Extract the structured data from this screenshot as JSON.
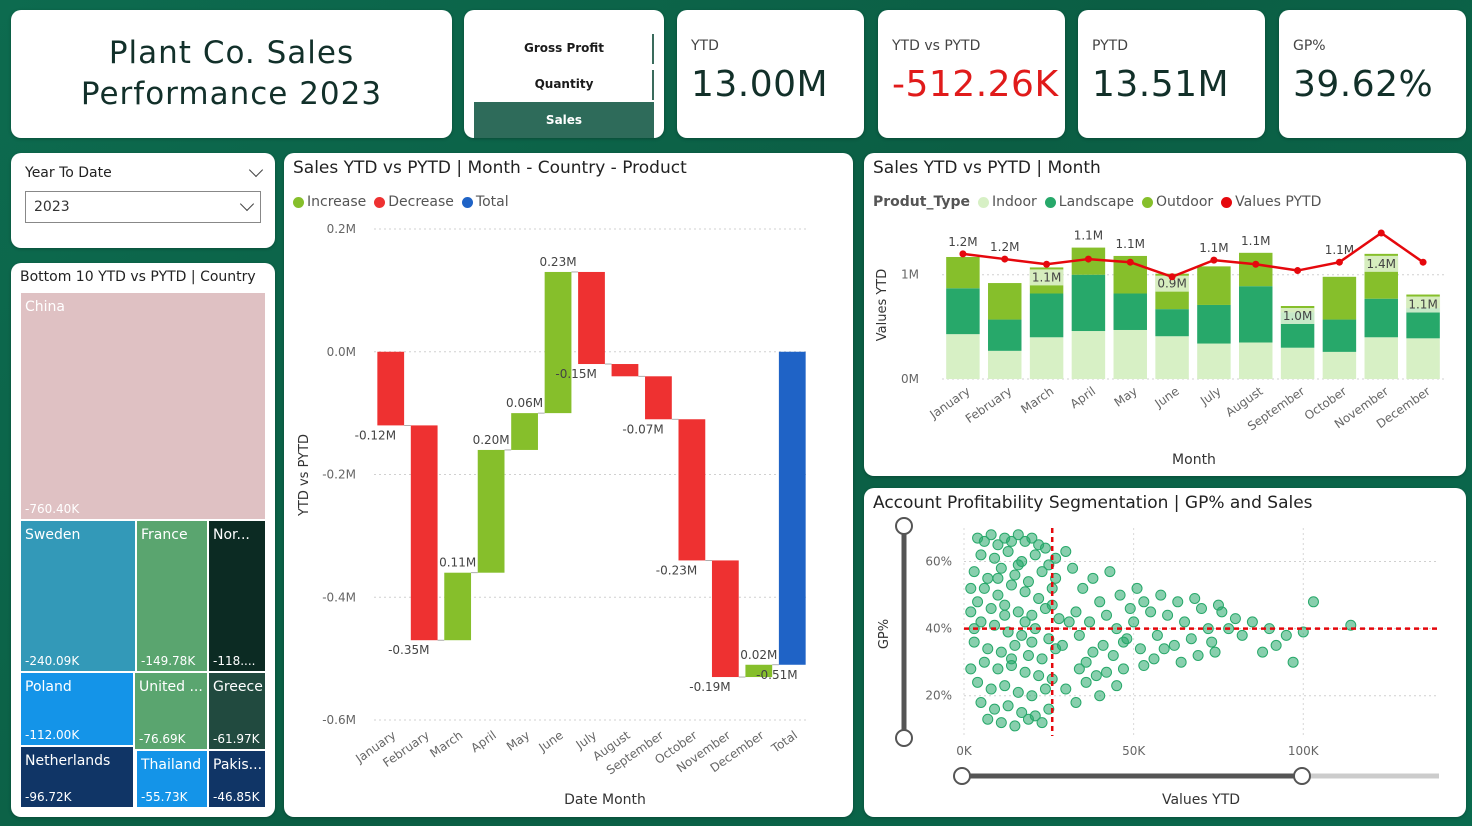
{
  "header": {
    "title_line1": "Plant Co. Sales",
    "title_line2": "Performance 2023"
  },
  "metric_selector": {
    "items": [
      "Gross Profit",
      "Quantity",
      "Sales"
    ],
    "active": "Sales"
  },
  "kpis": [
    {
      "label": "YTD",
      "value": "13.00M"
    },
    {
      "label": "YTD vs PYTD",
      "value": "-512.26K"
    },
    {
      "label": "PYTD",
      "value": "13.51M"
    },
    {
      "label": "GP%",
      "value": "39.62%"
    }
  ],
  "slicer": {
    "label": "Year To Date",
    "selected": "2023"
  },
  "colors": {
    "increase": "#86bf2b",
    "decrease": "#ee3131",
    "total": "#1f63c6",
    "indoor": "#d7f0c5",
    "landscape": "#27a86a",
    "outdoor": "#86bf2b",
    "pytd_line": "#e5080d",
    "scatter": "#27a86a"
  },
  "treemap": {
    "title": "Bottom 10 YTD vs PYTD | Country",
    "cells": [
      {
        "name": "China",
        "value": "-760.40K",
        "color": "#dfc1c3",
        "text": "#ffffff"
      },
      {
        "name": "Sweden",
        "value": "-240.09K",
        "color": "#3399b8",
        "text": "#ffffff"
      },
      {
        "name": "France",
        "value": "-149.78K",
        "color": "#5aa56f",
        "text": "#ffffff"
      },
      {
        "name": "Nor...",
        "value": "-118....",
        "color": "#0c2b23",
        "text": "#ffffff"
      },
      {
        "name": "Poland",
        "value": "-112.00K",
        "color": "#1494e8",
        "text": "#ffffff"
      },
      {
        "name": "United ...",
        "value": "-76.69K",
        "color": "#5aa56f",
        "text": "#ffffff"
      },
      {
        "name": "Greece",
        "value": "-61.97K",
        "color": "#214a3f",
        "text": "#ffffff"
      },
      {
        "name": "Netherlands",
        "value": "-96.72K",
        "color": "#103566",
        "text": "#ffffff"
      },
      {
        "name": "Thailand",
        "value": "-55.73K",
        "color": "#1494e8",
        "text": "#ffffff"
      },
      {
        "name": "Pakis...",
        "value": "-46.85K",
        "color": "#103566",
        "text": "#ffffff"
      }
    ]
  },
  "waterfall": {
    "title": "Sales YTD vs PYTD | Month - Country - Product",
    "legend": [
      "Increase",
      "Decrease",
      "Total"
    ],
    "xlabel": "Date Month",
    "ylabel": "YTD vs PYTD",
    "y_ticks": [
      "0.2M",
      "0.0M",
      "-0.2M",
      "-0.4M",
      "-0.6M"
    ]
  },
  "stacked": {
    "title": "Sales YTD vs PYTD | Month",
    "legend_title": "Produt_Type",
    "legend": [
      "Indoor",
      "Landscape",
      "Outdoor",
      "Values PYTD"
    ],
    "xlabel": "Month",
    "ylabel": "Values YTD",
    "y_ticks": [
      "1M",
      "0M"
    ]
  },
  "scatter": {
    "title": "Account Profitability Segmentation | GP% and Sales",
    "xlabel": "Values YTD",
    "ylabel": "GP%",
    "x_ticks": [
      "0K",
      "50K",
      "100K"
    ],
    "y_ticks": [
      "60%",
      "40%",
      "20%"
    ]
  },
  "chart_data": [
    {
      "type": "bar",
      "subtype": "waterfall",
      "title": "Sales YTD vs PYTD | Month - Country - Product",
      "xlabel": "Date Month",
      "ylabel": "YTD vs PYTD",
      "ylim": [
        -0.6,
        0.2
      ],
      "unit": "M",
      "categories": [
        "January",
        "February",
        "March",
        "April",
        "May",
        "June",
        "July",
        "August",
        "September",
        "October",
        "November",
        "December",
        "Total"
      ],
      "values": [
        -0.12,
        -0.35,
        0.11,
        0.2,
        0.06,
        0.23,
        -0.15,
        -0.02,
        -0.07,
        -0.23,
        -0.19,
        0.02,
        -0.51
      ],
      "labels": [
        "-0.12M",
        "-0.35M",
        "0.11M",
        "0.20M",
        "0.06M",
        "0.23M",
        "-0.15M",
        "",
        "-0.07M",
        "-0.23M",
        "-0.19M",
        "0.02M",
        "-0.51M"
      ],
      "kinds": [
        "decrease",
        "decrease",
        "increase",
        "increase",
        "increase",
        "increase",
        "decrease",
        "decrease",
        "decrease",
        "decrease",
        "decrease",
        "increase",
        "total"
      ]
    },
    {
      "type": "bar",
      "subtype": "stacked-with-line",
      "title": "Sales YTD vs PYTD | Month",
      "xlabel": "Month",
      "ylabel": "Values YTD",
      "ylim": [
        0,
        1.4
      ],
      "unit": "M",
      "categories": [
        "January",
        "February",
        "March",
        "April",
        "May",
        "June",
        "July",
        "August",
        "September",
        "October",
        "November",
        "December"
      ],
      "series": [
        {
          "name": "Indoor",
          "values": [
            0.43,
            0.27,
            0.4,
            0.46,
            0.47,
            0.41,
            0.34,
            0.35,
            0.3,
            0.26,
            0.4,
            0.39
          ]
        },
        {
          "name": "Landscape",
          "values": [
            0.44,
            0.3,
            0.42,
            0.54,
            0.35,
            0.26,
            0.37,
            0.54,
            0.34,
            0.31,
            0.37,
            0.29
          ]
        },
        {
          "name": "Outdoor",
          "values": [
            0.3,
            0.35,
            0.25,
            0.26,
            0.36,
            0.34,
            0.37,
            0.32,
            0.06,
            0.41,
            0.43,
            0.13
          ]
        },
        {
          "name": "Values PYTD",
          "values": [
            1.2,
            1.15,
            1.1,
            1.15,
            1.12,
            0.98,
            1.14,
            1.1,
            1.04,
            1.12,
            1.4,
            1.12
          ]
        }
      ],
      "data_labels_top": [
        "1.2M",
        "1.2M",
        "",
        "1.1M",
        "1.1M",
        "",
        "1.1M",
        "1.1M",
        "",
        "1.1M",
        "",
        ""
      ],
      "data_labels_inner": [
        "",
        "",
        "1.1M",
        "",
        "",
        "0.9M",
        "",
        "",
        "1.0M",
        "",
        "1.4M",
        "1.1M"
      ]
    },
    {
      "type": "scatter",
      "title": "Account Profitability Segmentation | GP% and Sales",
      "xlabel": "Values YTD",
      "ylabel": "GP%",
      "xlim": [
        0,
        140000
      ],
      "ylim": [
        8,
        70
      ],
      "reference_lines": {
        "x": 26000,
        "y": 40
      },
      "points": [
        [
          4000,
          67
        ],
        [
          6000,
          66
        ],
        [
          8000,
          68
        ],
        [
          10000,
          65
        ],
        [
          12000,
          67
        ],
        [
          14000,
          66
        ],
        [
          16000,
          68
        ],
        [
          18000,
          66
        ],
        [
          20000,
          67
        ],
        [
          22000,
          65
        ],
        [
          24000,
          64
        ],
        [
          5000,
          62
        ],
        [
          9000,
          61
        ],
        [
          13000,
          63
        ],
        [
          17000,
          60
        ],
        [
          21000,
          62
        ],
        [
          25000,
          59
        ],
        [
          3000,
          57
        ],
        [
          7000,
          55
        ],
        [
          11000,
          58
        ],
        [
          15000,
          56
        ],
        [
          19000,
          54
        ],
        [
          23000,
          57
        ],
        [
          27000,
          55
        ],
        [
          6000,
          52
        ],
        [
          10000,
          50
        ],
        [
          14000,
          53
        ],
        [
          18000,
          51
        ],
        [
          22000,
          49
        ],
        [
          26000,
          52
        ],
        [
          4000,
          48
        ],
        [
          8000,
          46
        ],
        [
          12000,
          47
        ],
        [
          16000,
          45
        ],
        [
          20000,
          44
        ],
        [
          24000,
          46
        ],
        [
          28000,
          43
        ],
        [
          5000,
          42
        ],
        [
          9000,
          41
        ],
        [
          13000,
          39
        ],
        [
          17000,
          38
        ],
        [
          21000,
          40
        ],
        [
          25000,
          37
        ],
        [
          3000,
          36
        ],
        [
          7000,
          34
        ],
        [
          11000,
          33
        ],
        [
          15000,
          35
        ],
        [
          19000,
          32
        ],
        [
          23000,
          31
        ],
        [
          27000,
          34
        ],
        [
          6000,
          30
        ],
        [
          10000,
          28
        ],
        [
          14000,
          29
        ],
        [
          18000,
          27
        ],
        [
          22000,
          26
        ],
        [
          4000,
          24
        ],
        [
          8000,
          22
        ],
        [
          12000,
          23
        ],
        [
          16000,
          21
        ],
        [
          20000,
          20
        ],
        [
          24000,
          22
        ],
        [
          5000,
          18
        ],
        [
          9000,
          16
        ],
        [
          13000,
          17
        ],
        [
          17000,
          15
        ],
        [
          21000,
          14
        ],
        [
          25000,
          16
        ],
        [
          7000,
          13
        ],
        [
          11000,
          12
        ],
        [
          15000,
          11
        ],
        [
          19000,
          13
        ],
        [
          23000,
          12
        ],
        [
          10000,
          55
        ],
        [
          12000,
          44
        ],
        [
          14000,
          31
        ],
        [
          16000,
          59
        ],
        [
          18000,
          42
        ],
        [
          20000,
          36
        ],
        [
          2000,
          45
        ],
        [
          2000,
          28
        ],
        [
          2000,
          52
        ],
        [
          3000,
          40
        ],
        [
          26000,
          25
        ],
        [
          26000,
          47
        ],
        [
          27000,
          61
        ],
        [
          30000,
          63
        ],
        [
          32000,
          58
        ],
        [
          33000,
          45
        ],
        [
          34000,
          38
        ],
        [
          35000,
          52
        ],
        [
          36000,
          30
        ],
        [
          37000,
          42
        ],
        [
          38000,
          55
        ],
        [
          39000,
          26
        ],
        [
          40000,
          48
        ],
        [
          41000,
          35
        ],
        [
          42000,
          44
        ],
        [
          43000,
          57
        ],
        [
          44000,
          32
        ],
        [
          45000,
          40
        ],
        [
          46000,
          50
        ],
        [
          47000,
          28
        ],
        [
          48000,
          37
        ],
        [
          49000,
          46
        ],
        [
          50000,
          42
        ],
        [
          51000,
          52
        ],
        [
          52000,
          34
        ],
        [
          53000,
          48
        ],
        [
          55000,
          45
        ],
        [
          57000,
          38
        ],
        [
          58000,
          50
        ],
        [
          60000,
          44
        ],
        [
          62000,
          35
        ],
        [
          63000,
          48
        ],
        [
          65000,
          42
        ],
        [
          67000,
          37
        ],
        [
          68000,
          49
        ],
        [
          70000,
          46
        ],
        [
          72000,
          40
        ],
        [
          74000,
          33
        ],
        [
          75000,
          47
        ],
        [
          30000,
          22
        ],
        [
          33000,
          18
        ],
        [
          36000,
          24
        ],
        [
          40000,
          20
        ],
        [
          45000,
          23
        ],
        [
          29000,
          35
        ],
        [
          31000,
          42
        ],
        [
          34000,
          28
        ],
        [
          38000,
          33
        ],
        [
          42000,
          27
        ],
        [
          47000,
          36
        ],
        [
          53000,
          29
        ],
        [
          56000,
          31
        ],
        [
          59000,
          34
        ],
        [
          64000,
          30
        ],
        [
          69000,
          32
        ],
        [
          73000,
          36
        ],
        [
          76000,
          45
        ],
        [
          78000,
          40
        ],
        [
          80000,
          43
        ],
        [
          82000,
          38
        ],
        [
          85000,
          42
        ],
        [
          88000,
          33
        ],
        [
          90000,
          40
        ],
        [
          92000,
          35
        ],
        [
          95000,
          38
        ],
        [
          97000,
          30
        ],
        [
          100000,
          39
        ],
        [
          103000,
          48
        ],
        [
          114000,
          41
        ]
      ]
    }
  ]
}
